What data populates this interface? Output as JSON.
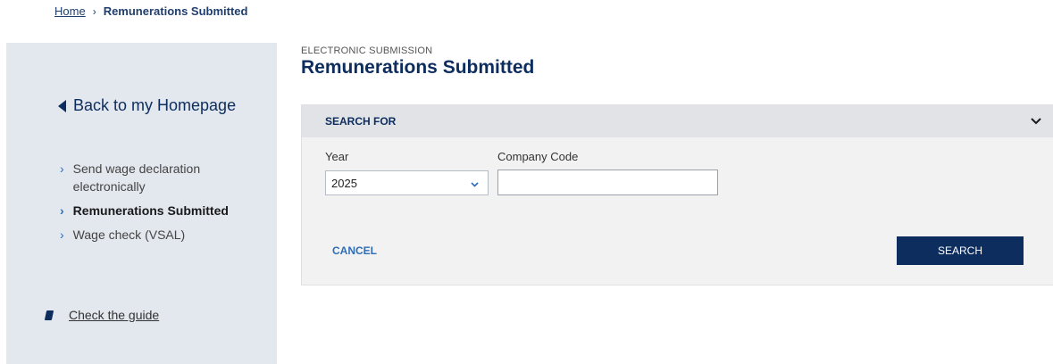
{
  "breadcrumb": {
    "home": "Home",
    "separator": "›",
    "current": "Remunerations Submitted"
  },
  "sidebar": {
    "back_label": "Back to my Homepage",
    "items": [
      {
        "label": "Send wage declaration electronically",
        "active": false
      },
      {
        "label": "Remunerations Submitted",
        "active": true
      },
      {
        "label": "Wage check (VSAL)",
        "active": false
      }
    ],
    "chevron": "›",
    "guide_label": "Check the guide"
  },
  "main": {
    "eyebrow": "ELECTRONIC SUBMISSION",
    "title": "Remunerations Submitted"
  },
  "search_panel": {
    "header": "SEARCH FOR",
    "year_label": "Year",
    "year_value": "2025",
    "company_label": "Company Code",
    "company_value": "",
    "company_placeholder": "",
    "cancel_label": "CANCEL",
    "search_label": "SEARCH"
  },
  "colors": {
    "navy": "#0d2d5e",
    "link_blue": "#2f6db5",
    "sidebar_bg": "#e3e7ee",
    "panel_bg": "#f2f2f2",
    "panel_header_bg": "#e1e3e7"
  },
  "icons": {
    "back": "triangle-left-icon",
    "nav_item": "chevron-right-icon",
    "guide": "book-icon",
    "panel_toggle": "chevron-down-icon",
    "select_arrow": "chevron-down-icon"
  }
}
